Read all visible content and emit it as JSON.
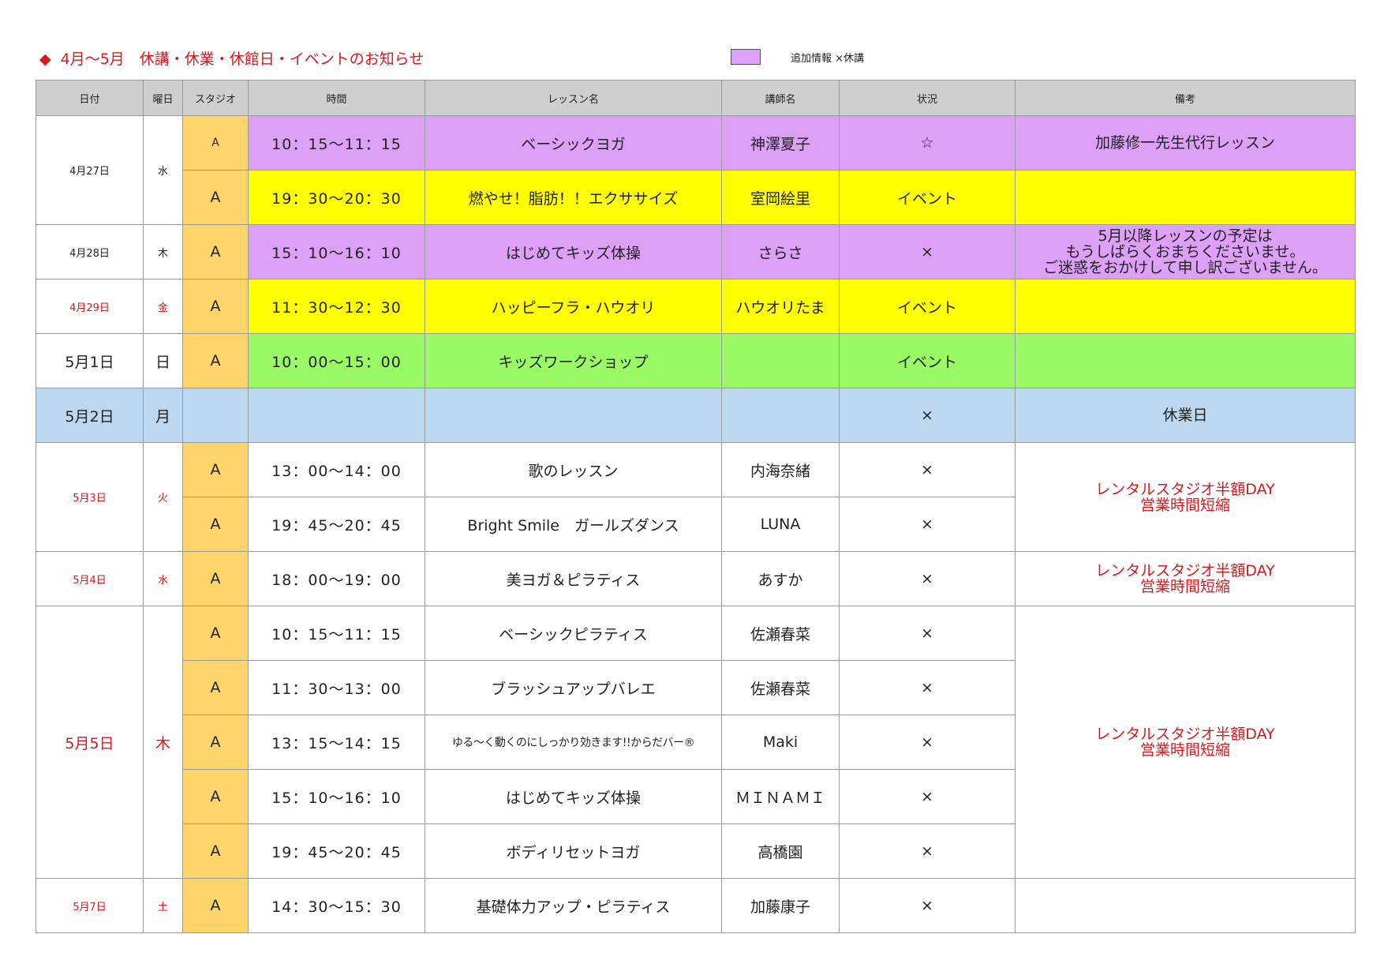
{
  "header": {
    "diamond": "◆",
    "title": "4月～5月　休講・休業・休館日・イベントのお知らせ",
    "legend_text": "追加情報 ×休講",
    "legend_color": "#dca0f6"
  },
  "colors": {
    "purple": "#dca0f6",
    "yellow": "#ffff00",
    "green": "#99fa66",
    "blue": "#bdd7ee",
    "studio": "#fed56b",
    "header_gray": "#cfcfcf",
    "red_text": "#d71920"
  },
  "columns": [
    "日付",
    "曜日",
    "スタジオ",
    "時間",
    "レッスン名",
    "講師名",
    "状況",
    "備考"
  ],
  "groups": [
    {
      "date": "4月27日",
      "dow": "水",
      "red": false,
      "size": "small",
      "rows": [
        {
          "studio": "A",
          "time": "10：15～11：15",
          "lesson": "ベーシックヨガ",
          "teacher": "神澤夏子",
          "status": "☆",
          "note": "加藤修一先生代行レッスン",
          "color": "purple"
        },
        {
          "studio": "A",
          "time": "19：30～20：30",
          "lesson": "燃やせ！脂肪！！エクササイズ",
          "teacher": "室岡絵里",
          "status": "イベント",
          "note": "",
          "color": "yellow"
        }
      ]
    },
    {
      "date": "4月28日",
      "dow": "木",
      "red": false,
      "size": "small",
      "rows": [
        {
          "studio": "A",
          "time": "15：10～16：10",
          "lesson": "はじめてキッズ体操",
          "teacher": "さらさ",
          "status": "×",
          "note_lines": [
            "5月以降レッスンの予定は",
            "もうしばらくおまちくださいませ。",
            "ご迷惑をおかけして申し訳ございません。"
          ],
          "color": "purple"
        }
      ]
    },
    {
      "date": "4月29日",
      "dow": "金",
      "red": true,
      "size": "small",
      "rows": [
        {
          "studio": "A",
          "time": "11：30～12：30",
          "lesson": "ハッピーフラ・ハウオリ",
          "teacher": "ハウオリたま",
          "status": "イベント",
          "note": "",
          "color": "yellow"
        }
      ]
    },
    {
      "date": "5月1日",
      "dow": "日",
      "red": false,
      "size": "large",
      "rows": [
        {
          "studio": "A",
          "time": "10：00～15：00",
          "lesson": "キッズワークショップ",
          "teacher": "",
          "status": "イベント",
          "note": "",
          "color": "green"
        }
      ]
    },
    {
      "date": "5月2日",
      "dow": "月",
      "red": false,
      "size": "large",
      "rows": [
        {
          "studio": "",
          "time": "",
          "lesson": "",
          "teacher": "",
          "status": "×",
          "note": "休業日",
          "color": "blue"
        }
      ]
    },
    {
      "date": "5月3日",
      "dow": "火",
      "red": true,
      "size": "small",
      "group_note_lines": [
        "レンタルスタジオ半額DAY",
        "営業時間短縮"
      ],
      "rows": [
        {
          "studio": "A",
          "time": "13：00～14：00",
          "lesson": "歌のレッスン",
          "teacher": "内海奈緒",
          "status": "×",
          "color": "white"
        },
        {
          "studio": "A",
          "time": "19：45～20：45",
          "lesson": "Bright Smile　ガールズダンス",
          "teacher": "LUNA",
          "status": "×",
          "color": "white"
        }
      ]
    },
    {
      "date": "5月4日",
      "dow": "水",
      "red": true,
      "size": "small",
      "group_note_lines": [
        "レンタルスタジオ半額DAY",
        "営業時間短縮"
      ],
      "rows": [
        {
          "studio": "A",
          "time": "18：00～19：00",
          "lesson": "美ヨガ＆ピラティス",
          "teacher": "あすか",
          "status": "×",
          "color": "white"
        }
      ]
    },
    {
      "date": "5月5日",
      "dow": "木",
      "red": true,
      "size": "large",
      "group_note_lines": [
        "レンタルスタジオ半額DAY",
        "営業時間短縮"
      ],
      "rows": [
        {
          "studio": "A",
          "time": "10：15～11：15",
          "lesson": "ベーシックピラティス",
          "teacher": "佐瀬春菜",
          "status": "×",
          "color": "white"
        },
        {
          "studio": "A",
          "time": "11：30～13：00",
          "lesson": "ブラッシュアップバレエ",
          "teacher": "佐瀬春菜",
          "status": "×",
          "color": "white"
        },
        {
          "studio": "A",
          "time": "13：15～14：15",
          "lesson": "ゆる～く動くのにしっかり効きます!!からだバー®",
          "teacher": "Maki",
          "status": "×",
          "color": "white",
          "tiny": true
        },
        {
          "studio": "A",
          "time": "15：10～16：10",
          "lesson": "はじめてキッズ体操",
          "teacher": "ＭＩＮＡＭＩ",
          "status": "×",
          "color": "white"
        },
        {
          "studio": "A",
          "time": "19：45～20：45",
          "lesson": "ボディリセットヨガ",
          "teacher": "高橋園",
          "status": "×",
          "color": "white"
        }
      ]
    },
    {
      "date": "5月7日",
      "dow": "土",
      "red": true,
      "size": "small",
      "rows": [
        {
          "studio": "A",
          "time": "14：30～15：30",
          "lesson": "基礎体力アップ・ピラティス",
          "teacher": "加藤康子",
          "status": "×",
          "note": "",
          "color": "white"
        }
      ]
    }
  ]
}
